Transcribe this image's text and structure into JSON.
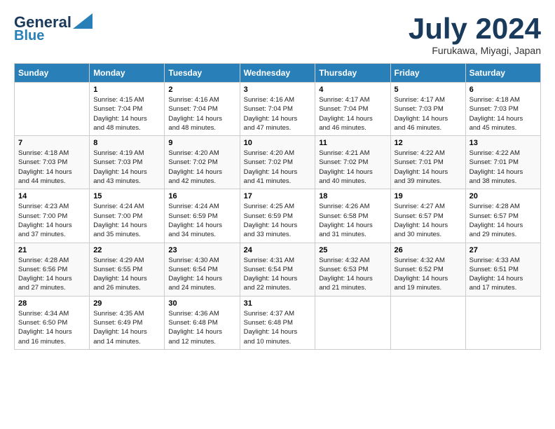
{
  "header": {
    "logo_line1": "General",
    "logo_line2": "Blue",
    "month": "July 2024",
    "location": "Furukawa, Miyagi, Japan"
  },
  "days_of_week": [
    "Sunday",
    "Monday",
    "Tuesday",
    "Wednesday",
    "Thursday",
    "Friday",
    "Saturday"
  ],
  "weeks": [
    [
      {
        "day": "",
        "content": ""
      },
      {
        "day": "1",
        "content": "Sunrise: 4:15 AM\nSunset: 7:04 PM\nDaylight: 14 hours\nand 48 minutes."
      },
      {
        "day": "2",
        "content": "Sunrise: 4:16 AM\nSunset: 7:04 PM\nDaylight: 14 hours\nand 48 minutes."
      },
      {
        "day": "3",
        "content": "Sunrise: 4:16 AM\nSunset: 7:04 PM\nDaylight: 14 hours\nand 47 minutes."
      },
      {
        "day": "4",
        "content": "Sunrise: 4:17 AM\nSunset: 7:04 PM\nDaylight: 14 hours\nand 46 minutes."
      },
      {
        "day": "5",
        "content": "Sunrise: 4:17 AM\nSunset: 7:03 PM\nDaylight: 14 hours\nand 46 minutes."
      },
      {
        "day": "6",
        "content": "Sunrise: 4:18 AM\nSunset: 7:03 PM\nDaylight: 14 hours\nand 45 minutes."
      }
    ],
    [
      {
        "day": "7",
        "content": "Sunrise: 4:18 AM\nSunset: 7:03 PM\nDaylight: 14 hours\nand 44 minutes."
      },
      {
        "day": "8",
        "content": "Sunrise: 4:19 AM\nSunset: 7:03 PM\nDaylight: 14 hours\nand 43 minutes."
      },
      {
        "day": "9",
        "content": "Sunrise: 4:20 AM\nSunset: 7:02 PM\nDaylight: 14 hours\nand 42 minutes."
      },
      {
        "day": "10",
        "content": "Sunrise: 4:20 AM\nSunset: 7:02 PM\nDaylight: 14 hours\nand 41 minutes."
      },
      {
        "day": "11",
        "content": "Sunrise: 4:21 AM\nSunset: 7:02 PM\nDaylight: 14 hours\nand 40 minutes."
      },
      {
        "day": "12",
        "content": "Sunrise: 4:22 AM\nSunset: 7:01 PM\nDaylight: 14 hours\nand 39 minutes."
      },
      {
        "day": "13",
        "content": "Sunrise: 4:22 AM\nSunset: 7:01 PM\nDaylight: 14 hours\nand 38 minutes."
      }
    ],
    [
      {
        "day": "14",
        "content": "Sunrise: 4:23 AM\nSunset: 7:00 PM\nDaylight: 14 hours\nand 37 minutes."
      },
      {
        "day": "15",
        "content": "Sunrise: 4:24 AM\nSunset: 7:00 PM\nDaylight: 14 hours\nand 35 minutes."
      },
      {
        "day": "16",
        "content": "Sunrise: 4:24 AM\nSunset: 6:59 PM\nDaylight: 14 hours\nand 34 minutes."
      },
      {
        "day": "17",
        "content": "Sunrise: 4:25 AM\nSunset: 6:59 PM\nDaylight: 14 hours\nand 33 minutes."
      },
      {
        "day": "18",
        "content": "Sunrise: 4:26 AM\nSunset: 6:58 PM\nDaylight: 14 hours\nand 31 minutes."
      },
      {
        "day": "19",
        "content": "Sunrise: 4:27 AM\nSunset: 6:57 PM\nDaylight: 14 hours\nand 30 minutes."
      },
      {
        "day": "20",
        "content": "Sunrise: 4:28 AM\nSunset: 6:57 PM\nDaylight: 14 hours\nand 29 minutes."
      }
    ],
    [
      {
        "day": "21",
        "content": "Sunrise: 4:28 AM\nSunset: 6:56 PM\nDaylight: 14 hours\nand 27 minutes."
      },
      {
        "day": "22",
        "content": "Sunrise: 4:29 AM\nSunset: 6:55 PM\nDaylight: 14 hours\nand 26 minutes."
      },
      {
        "day": "23",
        "content": "Sunrise: 4:30 AM\nSunset: 6:54 PM\nDaylight: 14 hours\nand 24 minutes."
      },
      {
        "day": "24",
        "content": "Sunrise: 4:31 AM\nSunset: 6:54 PM\nDaylight: 14 hours\nand 22 minutes."
      },
      {
        "day": "25",
        "content": "Sunrise: 4:32 AM\nSunset: 6:53 PM\nDaylight: 14 hours\nand 21 minutes."
      },
      {
        "day": "26",
        "content": "Sunrise: 4:32 AM\nSunset: 6:52 PM\nDaylight: 14 hours\nand 19 minutes."
      },
      {
        "day": "27",
        "content": "Sunrise: 4:33 AM\nSunset: 6:51 PM\nDaylight: 14 hours\nand 17 minutes."
      }
    ],
    [
      {
        "day": "28",
        "content": "Sunrise: 4:34 AM\nSunset: 6:50 PM\nDaylight: 14 hours\nand 16 minutes."
      },
      {
        "day": "29",
        "content": "Sunrise: 4:35 AM\nSunset: 6:49 PM\nDaylight: 14 hours\nand 14 minutes."
      },
      {
        "day": "30",
        "content": "Sunrise: 4:36 AM\nSunset: 6:48 PM\nDaylight: 14 hours\nand 12 minutes."
      },
      {
        "day": "31",
        "content": "Sunrise: 4:37 AM\nSunset: 6:48 PM\nDaylight: 14 hours\nand 10 minutes."
      },
      {
        "day": "",
        "content": ""
      },
      {
        "day": "",
        "content": ""
      },
      {
        "day": "",
        "content": ""
      }
    ]
  ]
}
